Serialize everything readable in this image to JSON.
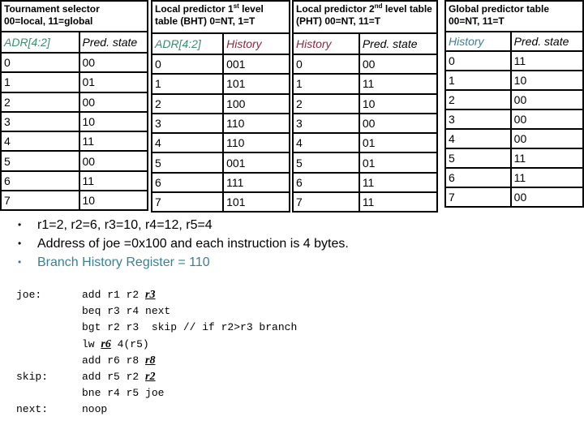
{
  "tables": [
    {
      "title_line1": "Tournament selector",
      "title_line2": "00=local, 11=global",
      "headers": [
        "ADR[4:2]",
        "Pred. state"
      ],
      "rows": [
        [
          "0",
          "00"
        ],
        [
          "1",
          "01"
        ],
        [
          "2",
          "00"
        ],
        [
          "3",
          "10"
        ],
        [
          "4",
          "11"
        ],
        [
          "5",
          "00"
        ],
        [
          "6",
          "11"
        ],
        [
          "7",
          "10"
        ]
      ]
    },
    {
      "title_pre": "Local predictor 1",
      "title_sup": "st",
      "title_post": " level table (BHT) 0=NT, 1=T",
      "headers": [
        "ADR[4:2]",
        "History"
      ],
      "rows": [
        [
          "0",
          "001"
        ],
        [
          "1",
          "101"
        ],
        [
          "2",
          "100"
        ],
        [
          "3",
          "110"
        ],
        [
          "4",
          "110"
        ],
        [
          "5",
          "001"
        ],
        [
          "6",
          "111"
        ],
        [
          "7",
          "101"
        ]
      ]
    },
    {
      "title_pre": "Local predictor 2",
      "title_sup": "nd",
      "title_post": " level table (PHT) 00=NT, 11=T",
      "headers": [
        "History",
        "Pred. state"
      ],
      "rows": [
        [
          "0",
          "00"
        ],
        [
          "1",
          "11"
        ],
        [
          "2",
          "10"
        ],
        [
          "3",
          "00"
        ],
        [
          "4",
          "01"
        ],
        [
          "5",
          "01"
        ],
        [
          "6",
          "11"
        ],
        [
          "7",
          "11"
        ]
      ]
    },
    {
      "title_line1": "Global predictor table",
      "title_line2": "00=NT, 11=T",
      "headers": [
        "History",
        "Pred. state"
      ],
      "rows": [
        [
          "0",
          "11"
        ],
        [
          "1",
          "10"
        ],
        [
          "2",
          "00"
        ],
        [
          "3",
          "00"
        ],
        [
          "4",
          "00"
        ],
        [
          "5",
          "11"
        ],
        [
          "6",
          "11"
        ],
        [
          "7",
          "00"
        ]
      ]
    }
  ],
  "bullets": [
    "r1=2, r2=6, r3=10, r4=12, r5=4",
    "Address of joe =0x100 and each instruction is 4 bytes.",
    "Branch History Register = 110"
  ],
  "bullet_glyph": "•",
  "code": [
    {
      "label": "joe:",
      "pre": "add r1 r2 ",
      "hl": "r3",
      "post": ""
    },
    {
      "label": "",
      "pre": "beq r3 r4 next",
      "hl": "",
      "post": ""
    },
    {
      "label": "",
      "pre": "bgt r2 r3  skip // if r2>r3 branch",
      "hl": "",
      "post": ""
    },
    {
      "label": "",
      "pre": "lw ",
      "hl": "r6",
      "post": " 4(r5)"
    },
    {
      "label": "",
      "pre": "add r6 r8 ",
      "hl": "r8",
      "post": ""
    },
    {
      "label": "skip:",
      "pre": "add r5 r2 ",
      "hl": "r2",
      "post": ""
    },
    {
      "label": "",
      "pre": "bne r4 r5 joe",
      "hl": "",
      "post": ""
    },
    {
      "label": "next:",
      "pre": "noop",
      "hl": "",
      "post": ""
    }
  ],
  "colors": {
    "adr_header": "#3c8c6e",
    "local_history_header": "#8a2a3a",
    "global_history_header": "#3a7f95",
    "bhr_bullet": "#3a7f95"
  }
}
